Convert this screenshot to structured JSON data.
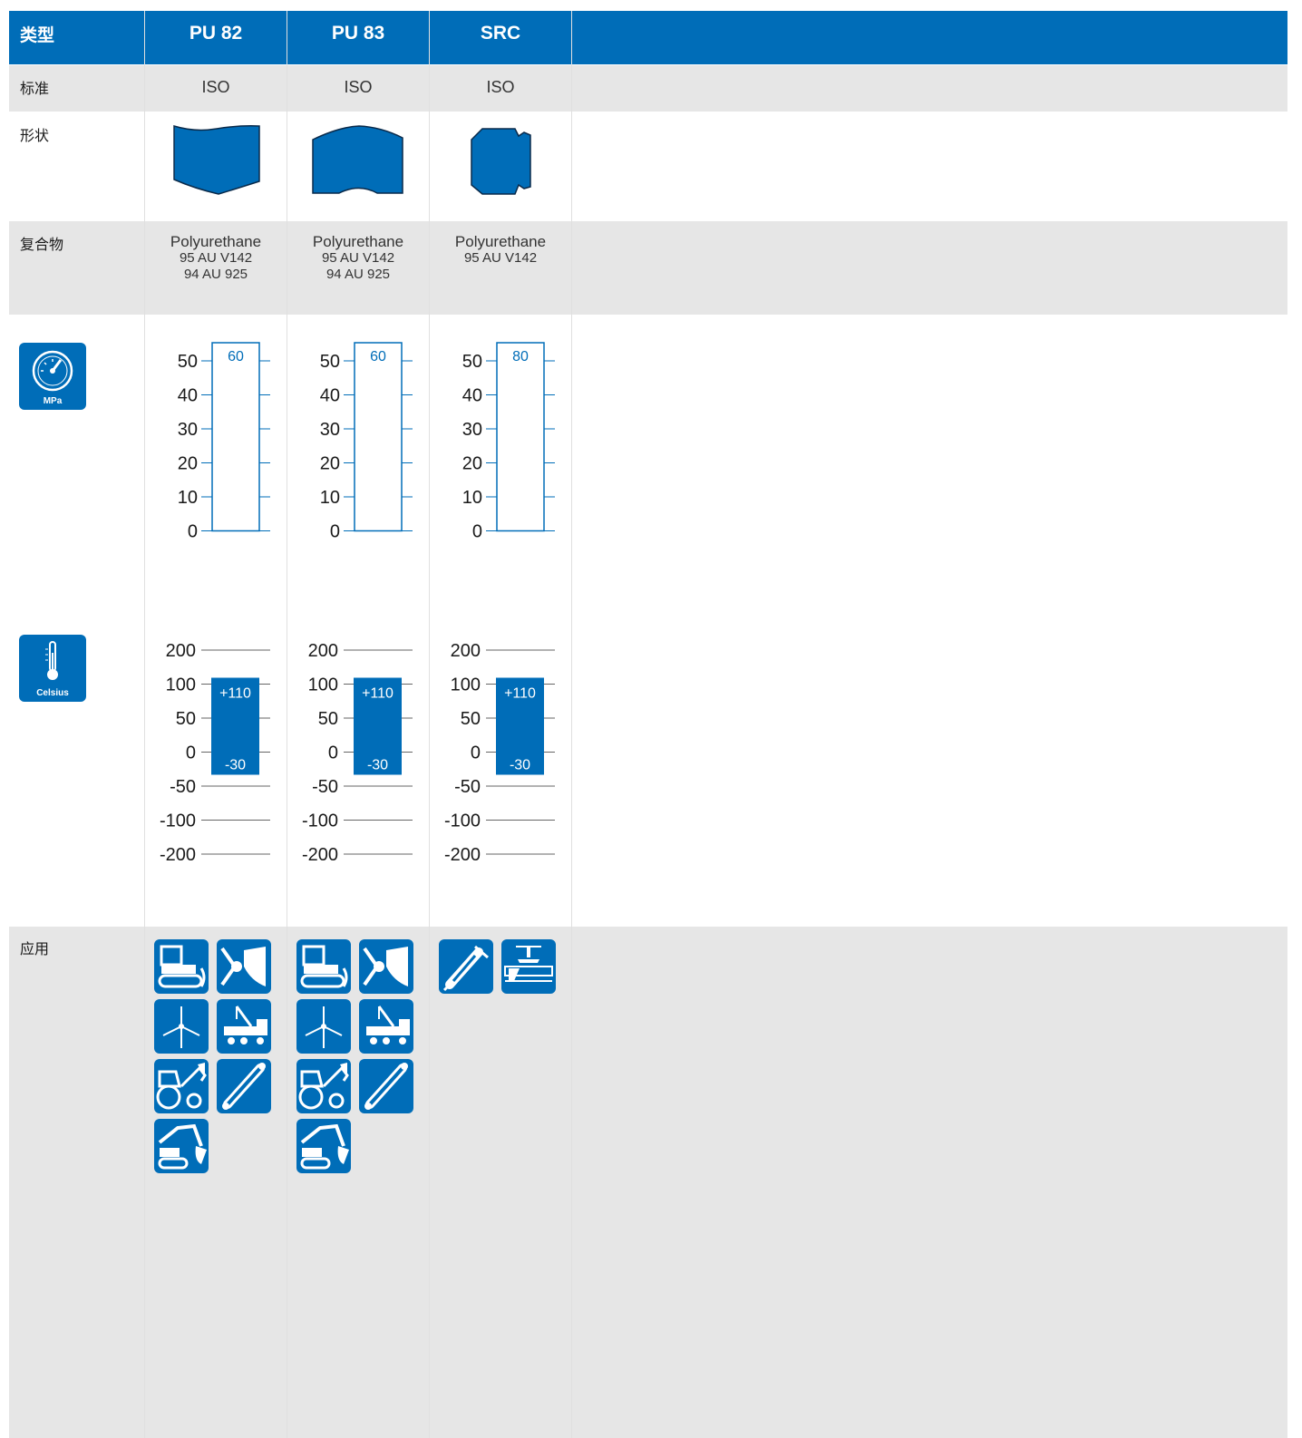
{
  "header": {
    "type_label": "类型"
  },
  "rows": {
    "standard": "标准",
    "shape": "形状",
    "compound": "复合物",
    "application": "应用"
  },
  "badges": {
    "pressure_unit": "MPa",
    "temperature_unit": "Celsius"
  },
  "pressure_ticks": [
    "50",
    "40",
    "30",
    "20",
    "10",
    "0"
  ],
  "temperature_ticks": [
    "200",
    "100",
    "50",
    "0",
    "-50",
    "-100",
    "-200"
  ],
  "colors": {
    "brand_blue": "#006db8",
    "band_grey": "#e6e6e6"
  },
  "products": [
    {
      "name": "PU 82",
      "standard": "ISO",
      "material": "Polyurethane",
      "grades": [
        "95 AU V142",
        "94 AU 925"
      ],
      "pressure_max": "60",
      "temp_max": "+110",
      "temp_min": "-30",
      "applications": [
        "crawler-dozer-icon",
        "bucket-loader-icon",
        "wind-turbine-icon",
        "truck-crane-icon",
        "tractor-loader-icon",
        "hydraulic-cylinder-icon",
        "excavator-icon"
      ]
    },
    {
      "name": "PU 83",
      "standard": "ISO",
      "material": "Polyurethane",
      "grades": [
        "95 AU V142",
        "94 AU 925"
      ],
      "pressure_max": "60",
      "temp_max": "+110",
      "temp_min": "-30",
      "applications": [
        "crawler-dozer-icon",
        "bucket-loader-icon",
        "wind-turbine-icon",
        "truck-crane-icon",
        "tractor-loader-icon",
        "hydraulic-cylinder-icon",
        "excavator-icon"
      ]
    },
    {
      "name": "SRC",
      "standard": "ISO",
      "material": "Polyurethane",
      "grades": [
        "95 AU V142"
      ],
      "pressure_max": "80",
      "temp_max": "+110",
      "temp_min": "-30",
      "applications": [
        "jackhammer-icon",
        "press-machine-icon"
      ]
    }
  ]
}
